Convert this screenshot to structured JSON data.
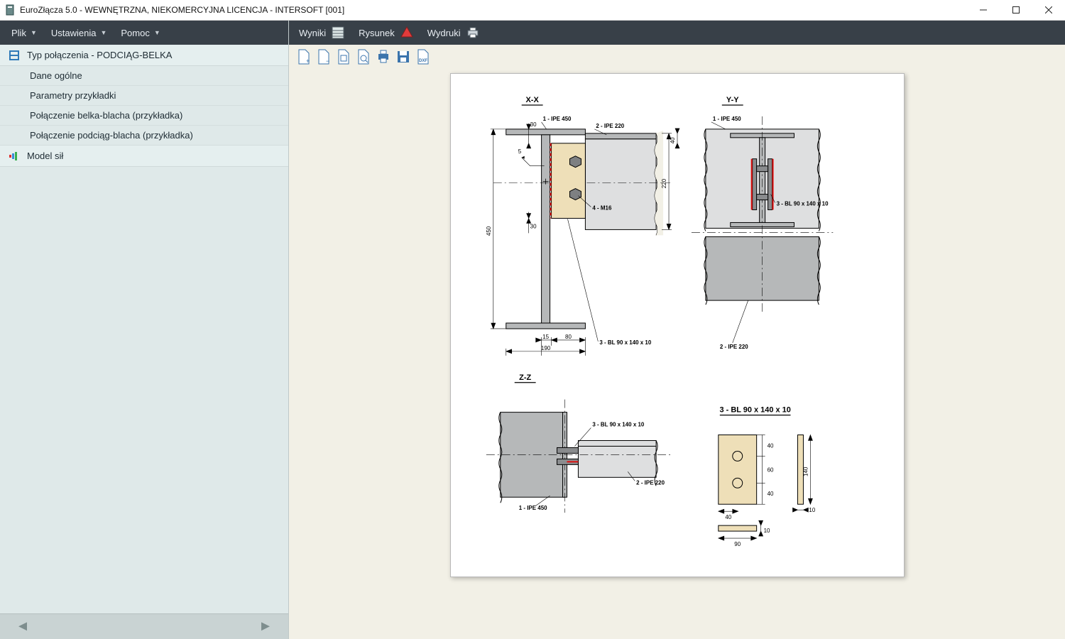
{
  "title": "EuroZłącza 5.0 - WEWNĘTRZNA, NIEKOMERCYJNA LICENCJA - INTERSOFT [001]",
  "menubar": {
    "file": "Plik",
    "settings": "Ustawienia",
    "help": "Pomoc"
  },
  "toolbar": {
    "results": "Wyniki",
    "drawing": "Rysunek",
    "printouts": "Wydruki"
  },
  "sidebar": {
    "header1": "Typ połączenia - PODCIĄG-BELKA",
    "items": [
      "Dane ogólne",
      "Parametry przykładki",
      "Połączenie belka-blacha (przykładka)",
      "Połączenie podciąg-blacha (przykładka)"
    ],
    "header2": "Model sił"
  },
  "drawing": {
    "section_xx": "X-X",
    "section_yy": "Y-Y",
    "section_zz": "Z-Z",
    "label_ipe450": "1 - IPE 450",
    "label_ipe220": "2 - IPE 220",
    "label_bl": "3 - BL 90 x 140 x 10",
    "label_m16": "4 - M16",
    "weld_sym": "5",
    "dim_450": "450",
    "dim_220": "220",
    "dim_40": "40",
    "dim_30_top": "30",
    "dim_30_bot": "30",
    "dim_15": "15",
    "dim_80": "80",
    "dim_190": "190",
    "dim_90": "90",
    "dim_10": "10",
    "dim_140": "140",
    "dim_60": "60",
    "plate_title": "3 - BL 90 x 140 x 10"
  }
}
